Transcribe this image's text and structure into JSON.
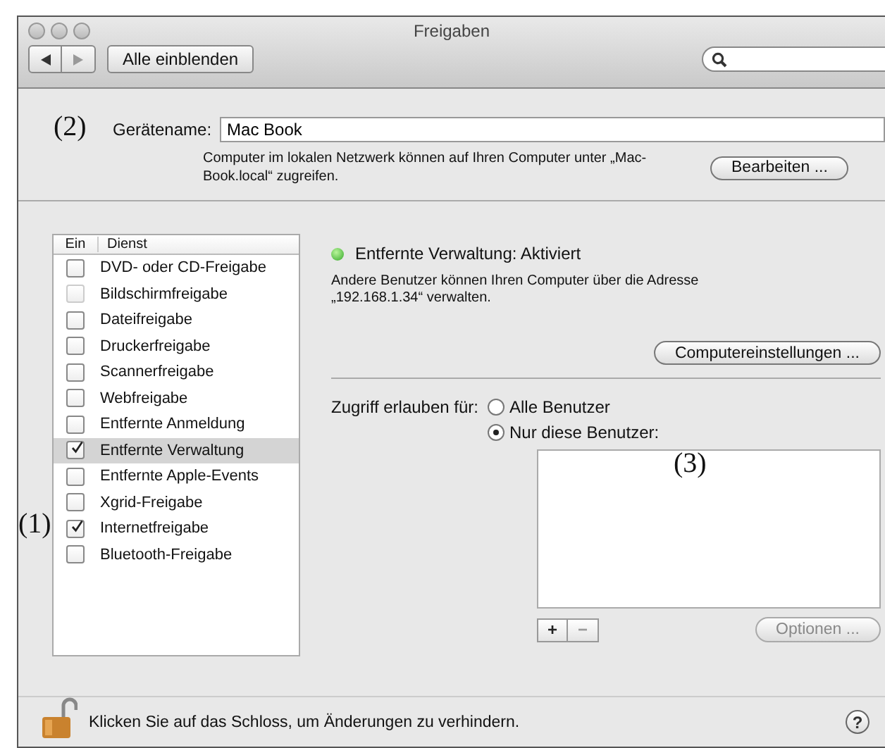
{
  "window": {
    "title": "Freigaben"
  },
  "toolbar": {
    "show_all": "Alle einblenden"
  },
  "device": {
    "annotation": "(2)",
    "label": "Gerätename:",
    "value": "Mac Book",
    "note": "Computer im lokalen Netzwerk können auf Ihren Computer unter „Mac-Book.local“ zugreifen.",
    "edit_button": "Bearbeiten ..."
  },
  "services": {
    "annotation": "(1)",
    "columns": [
      "Ein",
      "Dienst"
    ],
    "items": [
      {
        "name": "DVD- oder CD-Freigabe",
        "checked": false,
        "disabled": false,
        "selected": false
      },
      {
        "name": "Bildschirmfreigabe",
        "checked": false,
        "disabled": true,
        "selected": false
      },
      {
        "name": "Dateifreigabe",
        "checked": false,
        "disabled": false,
        "selected": false
      },
      {
        "name": "Druckerfreigabe",
        "checked": false,
        "disabled": false,
        "selected": false
      },
      {
        "name": "Scannerfreigabe",
        "checked": false,
        "disabled": false,
        "selected": false
      },
      {
        "name": "Webfreigabe",
        "checked": false,
        "disabled": false,
        "selected": false
      },
      {
        "name": "Entfernte Anmeldung",
        "checked": false,
        "disabled": false,
        "selected": false
      },
      {
        "name": "Entfernte Verwaltung",
        "checked": true,
        "disabled": false,
        "selected": true
      },
      {
        "name": "Entfernte Apple-Events",
        "checked": false,
        "disabled": false,
        "selected": false
      },
      {
        "name": "Xgrid-Freigabe",
        "checked": false,
        "disabled": false,
        "selected": false
      },
      {
        "name": "Internetfreigabe",
        "checked": true,
        "disabled": false,
        "selected": false
      },
      {
        "name": "Bluetooth-Freigabe",
        "checked": false,
        "disabled": false,
        "selected": false
      }
    ]
  },
  "status": {
    "on": true,
    "text": "Entfernte Verwaltung: Aktiviert"
  },
  "description": "Andere Benutzer können Ihren Computer über die Adresse „192.168.1.34“ verwalten.",
  "settings_button": "Computereinstellungen ...",
  "access": {
    "label": "Zugriff erlauben für:",
    "options": [
      {
        "label": "Alle Benutzer",
        "selected": false
      },
      {
        "label": "Nur diese Benutzer:",
        "selected": true
      }
    ]
  },
  "users": {
    "annotation": "(3)",
    "add_button": "+",
    "remove_button": "−",
    "options_button": {
      "label": "Optionen ...",
      "disabled": true
    }
  },
  "footer": {
    "locked": false,
    "text": "Klicken Sie auf das Schloss, um Änderungen zu verhindern.",
    "help_button": "?"
  }
}
